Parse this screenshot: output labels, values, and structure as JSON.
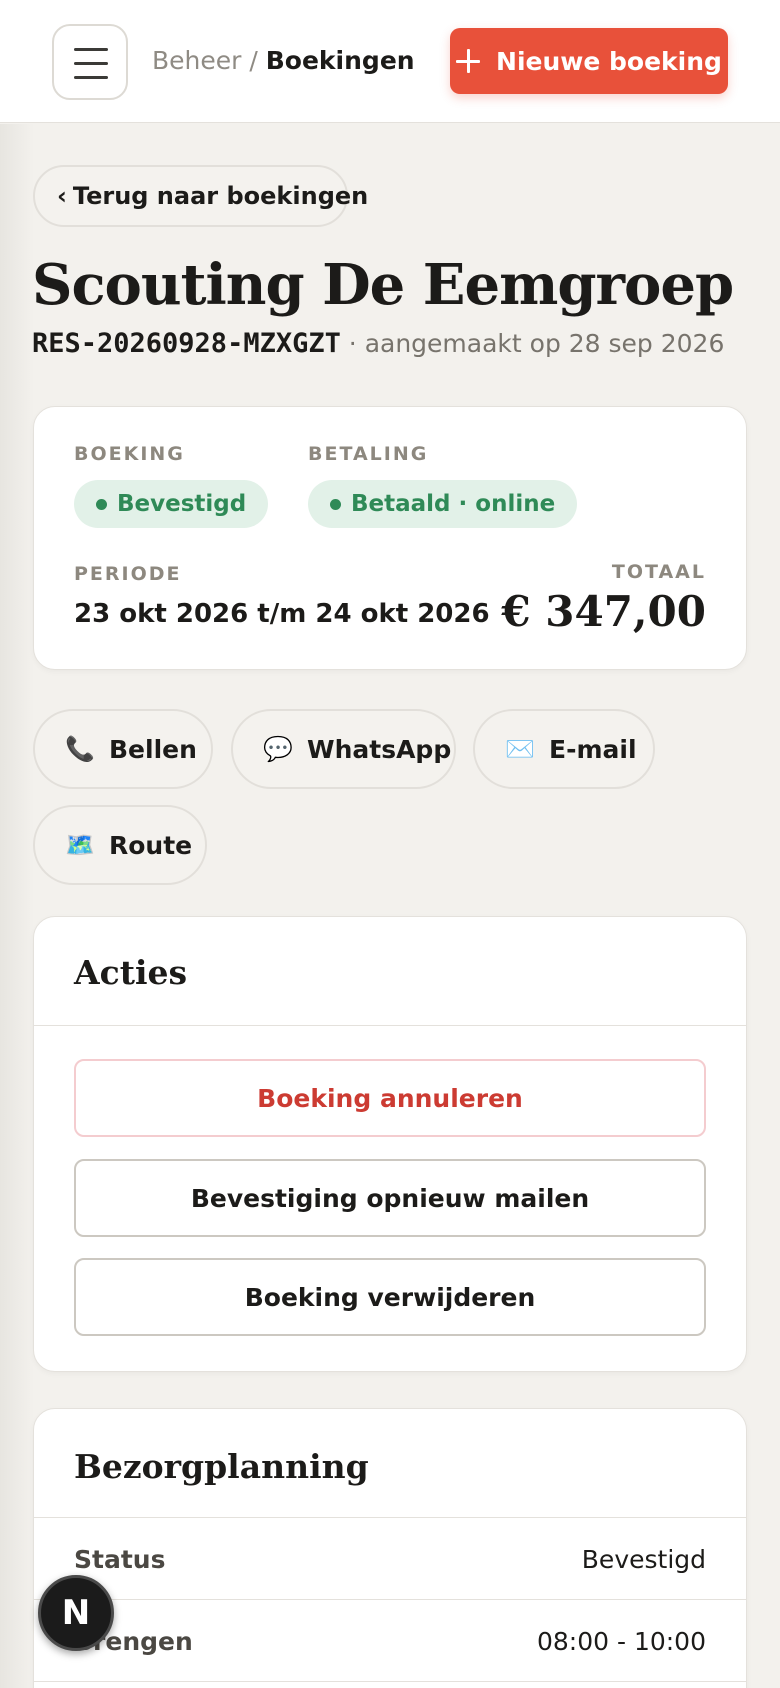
{
  "header": {
    "breadcrumb_parent": "Beheer",
    "breadcrumb_sep": " / ",
    "breadcrumb_current": "Boekingen",
    "new_button_label": "Nieuwe boeking"
  },
  "back_link": {
    "chevron": "‹",
    "label": "Terug naar boekingen"
  },
  "booking": {
    "title": "Scouting De Eemgroep",
    "reference": "RES-20260928-MZXGZT",
    "created_meta": " · aangemaakt op 28 sep 2026"
  },
  "summary": {
    "booking_label": "BOEKING",
    "booking_status": "Bevestigd",
    "payment_label": "BETALING",
    "payment_status": "Betaald · online",
    "period_label": "PERIODE",
    "period_value": "23 okt 2026 t/m 24 okt 2026",
    "total_label": "TOTAAL",
    "total_value": "€ 347,00",
    "status_color": "#2f8a57"
  },
  "contact": [
    {
      "icon": "phone-icon",
      "glyph": "📞",
      "label": "Bellen"
    },
    {
      "icon": "chat-icon",
      "glyph": "💬",
      "label": "WhatsApp"
    },
    {
      "icon": "mail-icon",
      "glyph": "✉️",
      "label": "E-mail"
    },
    {
      "icon": "map-icon",
      "glyph": "🗺️",
      "label": "Route"
    }
  ],
  "actions": {
    "title": "Acties",
    "cancel_label": "Boeking annuleren",
    "resend_label": "Bevestiging opnieuw mailen",
    "delete_label": "Boeking verwijderen"
  },
  "planning": {
    "title": "Bezorgplanning",
    "rows": [
      {
        "key": "Status",
        "value": "Bevestigd"
      },
      {
        "key": "Brengen",
        "value": "08:00 - 10:00"
      }
    ]
  },
  "floating_badge": {
    "letter": "N"
  },
  "colors": {
    "accent": "#e8513a",
    "danger": "#cc3b32",
    "success": "#2f8a57",
    "background": "#f3f1ed"
  }
}
